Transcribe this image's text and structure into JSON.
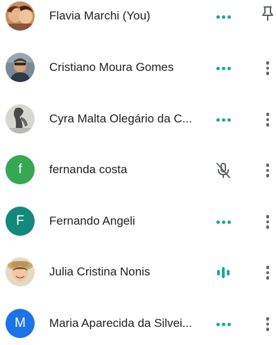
{
  "participants": [
    {
      "name": "Flavia Marchi (You)",
      "avatar_type": "photo",
      "status_icon": "more-horiz-dots-icon",
      "action_icon": "pin-icon"
    },
    {
      "name": "Cristiano Moura Gomes",
      "avatar_type": "photo",
      "status_icon": "more-horiz-dots-icon",
      "action_icon": "more-vert-icon"
    },
    {
      "name": "Cyra Malta Olegário da C...",
      "avatar_type": "photo",
      "status_icon": "more-horiz-dots-icon",
      "action_icon": "more-vert-icon"
    },
    {
      "name": "fernanda costa",
      "avatar_type": "initial",
      "initial": "f",
      "avatar_color": "#34a853",
      "status_icon": "mic-off-icon",
      "action_icon": "more-vert-icon"
    },
    {
      "name": "Fernando Angeli",
      "avatar_type": "initial",
      "initial": "F",
      "avatar_color": "#12897a",
      "status_icon": "more-horiz-dots-icon",
      "action_icon": "more-vert-icon"
    },
    {
      "name": "Julia Cristina Nonis",
      "avatar_type": "photo",
      "status_icon": "speaking-bars-icon",
      "action_icon": "more-vert-icon"
    },
    {
      "name": "Maria Aparecida da Silvei...",
      "avatar_type": "initial",
      "initial": "M",
      "avatar_color": "#1a73e8",
      "status_icon": "more-horiz-dots-icon",
      "action_icon": "more-vert-icon"
    }
  ],
  "colors": {
    "accent_teal": "#1aa89a",
    "icon_gray": "#5f6368",
    "text": "#202124"
  }
}
